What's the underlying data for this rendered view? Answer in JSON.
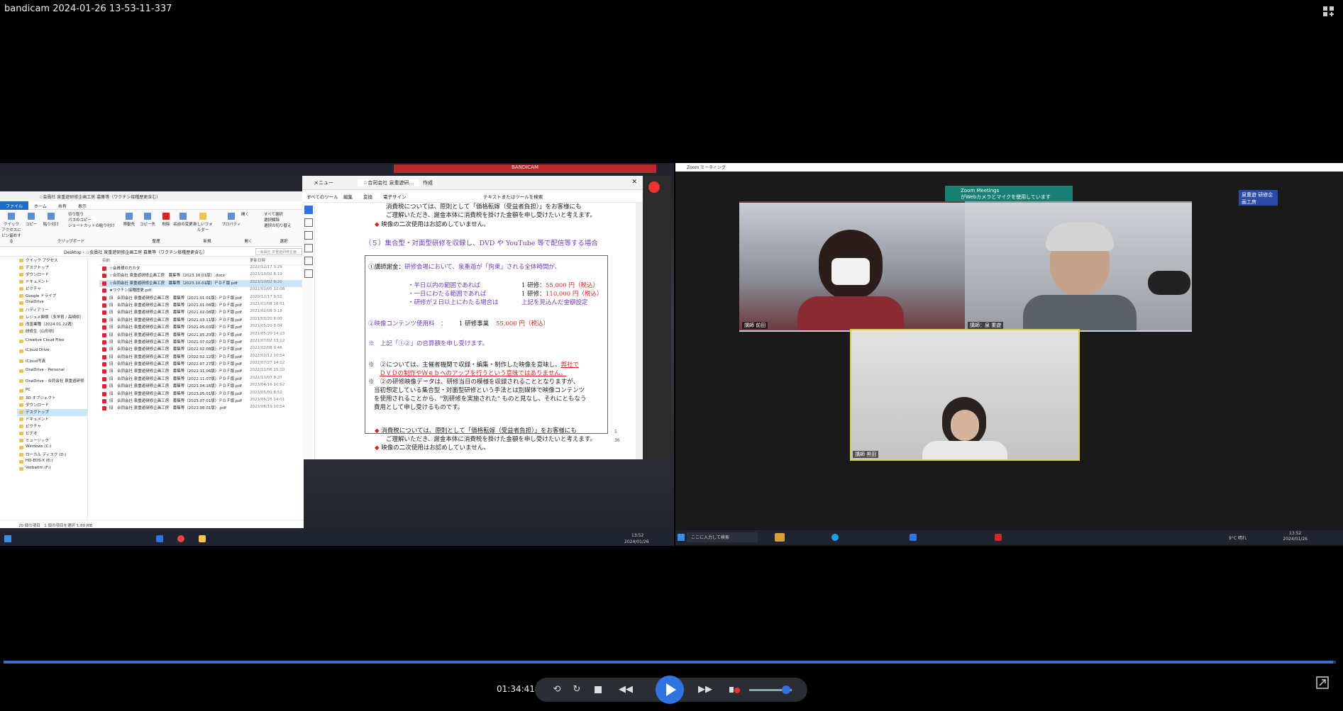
{
  "window": {
    "title": "bandicam 2024-01-26 13-53-11-337"
  },
  "player": {
    "time": "01:34:41",
    "progress": 0.998,
    "volume": 0.87,
    "icons": [
      "layout-toggle-icon",
      "loop-icon",
      "repeat-icon",
      "stop-icon",
      "rewind-icon",
      "play-icon",
      "forward-icon",
      "mute-icon",
      "expand-icon"
    ]
  },
  "explorer": {
    "title": "☆会員社 泉重遊研修企画工房 募集等（ワクチン接種歴更含む）",
    "tabs": [
      "ファイル",
      "ホーム",
      "共有",
      "表示"
    ],
    "ribbon": [
      "クイック アクセスにピン留めする",
      "コピー",
      "貼り付け",
      "切り取り",
      "パスのコピー",
      "ショートカットの貼り付け",
      "移動先",
      "コピー先",
      "削除",
      "名前の変更",
      "新しいフォルダー",
      "プロパティ",
      "開く",
      "すべて選択",
      "選択解除",
      "選択の切り替え"
    ],
    "ribbon_groups": [
      "クリップボード",
      "整理",
      "新規",
      "開く",
      "選択"
    ],
    "address": "Desktop › ☆会員社 泉重遊研修企画工房 募集等（ワクチン接種歴更含む）",
    "search_placeholder": "☆会員社 泉重遊研修企画...",
    "nav": [
      "クイック アクセス",
      "デスクトップ",
      "ダウンロード",
      "ドキュメント",
      "ピクチャ",
      "Google ドライブ",
      "OneDrive",
      "ハディアリー",
      "レジュメ関係（多学育 / 高崎県）",
      "改富業種（2024.01.22週）",
      "研修生（山形県）",
      "Creative Cloud Files",
      "iCloud Drive",
      "iCloud写真",
      "OneDrive - Personal",
      "OneDrive - 合同会社 泉重遊研修",
      "PC",
      "3D オブジェクト",
      "ダウンロード",
      "デスクトップ",
      "ドキュメント",
      "ピクチャ",
      "ビデオ",
      "ミュージック",
      "Windows (C:)",
      "ローカル ディスク (D:)",
      "HD-EDS-X (E:)",
      "Verbatim (F:)"
    ],
    "col_name": "名前",
    "col_date": "更新日時",
    "files": [
      {
        "name": "☆会員様の方カタ",
        "date": "2022/12/17 9:29"
      },
      {
        "name": "☆合同会社 泉重遊研修企画工房　募集等（2023.10.01版）.docx",
        "date": "2023/10/02 8:19"
      },
      {
        "name": "☆合同会社 泉重遊研修企画工房　募集等（2023.10.01版）ＰＤＦ版.pdf",
        "date": "2023/10/02 8:20"
      },
      {
        "name": "★ワクチン接種歴更.pdf",
        "date": "2022/01/05 12:08"
      },
      {
        "name": "旧　合同会社 泉重遊研修企画工房　募集等（2021.01.01版）ＰＤＦ版.pdf",
        "date": "2020/12/17 9:51"
      },
      {
        "name": "旧　合同会社 泉重遊研修企画工房　募集等（2021.01.08版）ＰＤＦ版.pdf",
        "date": "2021/01/08 18:51"
      },
      {
        "name": "旧　合同会社 泉重遊研修企画工房　募集等（2021.02.08版）ＰＤＦ版.pdf",
        "date": "2021/02/08 9:18"
      },
      {
        "name": "旧　合同会社 泉重遊研修企画工房　募集等（2021.03.11版）ＰＤＦ版.pdf",
        "date": "2021/03/20 8:00"
      },
      {
        "name": "旧　合同会社 泉重遊研修企画工房　募集等（2021.05.03版）ＰＤＦ版.pdf",
        "date": "2021/05/20 8:04"
      },
      {
        "name": "旧　合同会社 泉重遊研修企画工房　募集等（2021.05.20版）ＰＤＦ版.pdf",
        "date": "2021/05/20 14:23"
      },
      {
        "name": "旧　合同会社 泉重遊研修企画工房　募集等（2021.07.02版）ＰＤＦ版.pdf",
        "date": "2021/07/02 13:12"
      },
      {
        "name": "旧　合同会社 泉重遊研修企画工房　募集等（2022.02.08版）ＰＤＦ版.pdf",
        "date": "2022/02/08 9:46"
      },
      {
        "name": "旧　合同会社 泉重遊研修企画工房　募集等（2022.02.12版）ＰＤＦ版.pdf",
        "date": "2022/02/12 10:54"
      },
      {
        "name": "旧　合同会社 泉重遊研修企画工房　募集等（2022.07.27版）ＰＤＦ版.pdf",
        "date": "2022/07/27 14:12"
      },
      {
        "name": "旧　合同会社 泉重遊研修企画工房　募集等（2022.11.06版）ＰＤＦ版.pdf",
        "date": "2022/11/06 15:10"
      },
      {
        "name": "旧　合同会社 泉重遊研修企画工房　募集等（2022.11.07版）ＰＤＦ版.pdf",
        "date": "2022/11/07 8:27"
      },
      {
        "name": "旧　合同会社 泉重遊研修企画工房　募集等（2023.04.16版）ＰＤＦ版.pdf",
        "date": "2023/04/16 10:52"
      },
      {
        "name": "旧　合同会社 泉重遊研修企画工房　募集等（2023.05.01版）ＰＤＦ版.pdf",
        "date": "2023/05/01 8:52"
      },
      {
        "name": "旧　合同会社 泉重遊研修企画工房　募集等（2023.07.01版）ＰＤＦ版.pdf",
        "date": "2023/06/25 14:01"
      },
      {
        "name": "旧　合同会社 泉重遊研修企画工房　募集等（2023.08.01版）.pdf",
        "date": "2023/08/19 10:54"
      }
    ],
    "status": "20 個の項目　1 個の項目を選択 1.89 MB"
  },
  "pdf": {
    "tab_title": "☆合同会社 泉重遊研...",
    "menu_label": "メニュー",
    "new_label": "作成",
    "menu": [
      "すべてのツール",
      "編集",
      "変換",
      "電子サイン"
    ],
    "search_placeholder": "テキストまたはツールを検索",
    "page_number": "5",
    "page_total": "36",
    "page": {
      "top_note_1": "消費税については、原則として「価格転嫁（受益者負担）」をお客様にも",
      "top_note_2": "ご理解いただき、謝金本体に消費税を掛けた金額を申し受けたいと考えます。",
      "top_note_3": "映像の二次使用はお認めしていません。",
      "heading": "（５）集合型・対面型研修を収録し、DVD や YouTube 等で配信等する場合",
      "fee_title_1": "①講師謝金：",
      "fee_title_2": "研修会場において、泉重遊が「拘束」される全体時間が、",
      "r1_label": "・半日以内の範囲であれば",
      "r1_unit": "1 研修：",
      "r1_value": "55,000 円（税込）",
      "r2_label": "・一日にわたる範囲であれば",
      "r2_unit": "1 研修：",
      "r2_value": "110,000 円（税込）",
      "r3_label": "・研修が２日以上にわたる場合は",
      "r3_value": "上記を見込んだ金額設定",
      "video_label": "②映像コンテンツ使用料　：",
      "video_unit": "1 研修事業",
      "video_value": "55,000 円（税込）",
      "sum_note": "※　上記「①②」の合算額を申し受けます。",
      "n1a": "※　②については、主催者機関で収録・編集・制作した映像を意味し、",
      "n1b": "弊社で",
      "n1c": "ＤＶＤの制作やＷｅｂへのアップを行うという意味ではありません。",
      "n2a": "※　②の研修映像データは、研修当日の模様を収録されることとなりますが、",
      "n2b": "当初想定している集合型・対面型研修という手法とは別媒体で映像コンテンツ",
      "n2c": "を使用されることから、\"別研修を実施された\" ものと見なし、それにともなう",
      "n2d": "費用として申し受けるものです。",
      "bottom_1": "消費税については、原則として「価格転嫁（受益者負担）」をお客様にも",
      "bottom_2": "ご理解いただき、謝金本体に消費税を掛けた金額を申し受けたいと考えます。",
      "bottom_3": "映像の二次使用はお認めしていません。",
      "footer_page": "5"
    }
  },
  "bandicam_bar": "BANDICAM",
  "zoom": {
    "window_title": "Zoom ミーティング",
    "notification_title": "Zoom Meetings",
    "notification_text": "がWebカメラとマイクを使用しています",
    "top_right_label": "泉重遊 研修企画工房",
    "participants": [
      {
        "name": "講師 前田",
        "active": false
      },
      {
        "name": "講師：泉 重遊",
        "active": false
      },
      {
        "name": "講師 黒田",
        "active": true
      }
    ],
    "search_placeholder": "ここに入力して検索",
    "weather": "9°C 晴れ",
    "clock_time": "13:52",
    "clock_date": "2024/01/26"
  },
  "left_taskbar": {
    "clock_time": "13:52",
    "clock_date": "2024/01/26"
  },
  "colors": {
    "accent": "#2f74e0",
    "red_text": "#d22222",
    "purple_text": "#6a3dbb",
    "active_tile": "#d7d04a"
  }
}
